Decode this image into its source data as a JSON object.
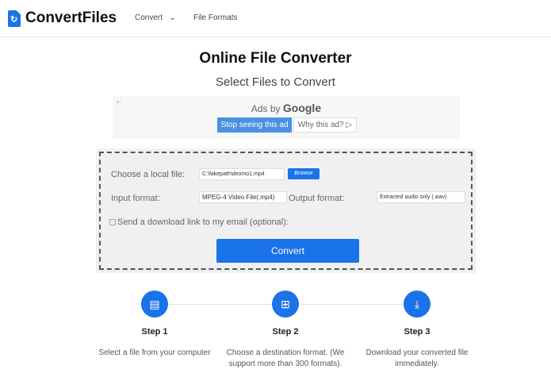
{
  "header": {
    "brand": "ConvertFiles",
    "nav": [
      "Convert",
      "File Formats"
    ]
  },
  "title": "Online File Converter",
  "subtitle": "Select Files to Convert",
  "ad": {
    "ads_by": "Ads by",
    "google": "Google",
    "stop": "Stop seeing this ad",
    "why": "Why this ad? ▷"
  },
  "form": {
    "local_label": "Choose a local file:",
    "file_value": "C:\\fakepath\\deomo1.mp4",
    "browse": "Browse",
    "input_label": "Input format:",
    "input_value": "MPEG-4 Video File(.mp4)",
    "output_label": "Output format:",
    "output_value": "Extracted audio only (.wav)",
    "email_label": "Send a download link to my email (optional):",
    "convert": "Convert"
  },
  "steps": [
    {
      "title": "Step 1",
      "desc": "Select a file from your computer",
      "icon": "file-icon"
    },
    {
      "title": "Step 2",
      "desc": "Choose a destination format. (We support more than 300 formats).",
      "icon": "grid-icon"
    },
    {
      "title": "Step 3",
      "desc": "Download your converted file immediately.",
      "icon": "download-icon"
    }
  ]
}
